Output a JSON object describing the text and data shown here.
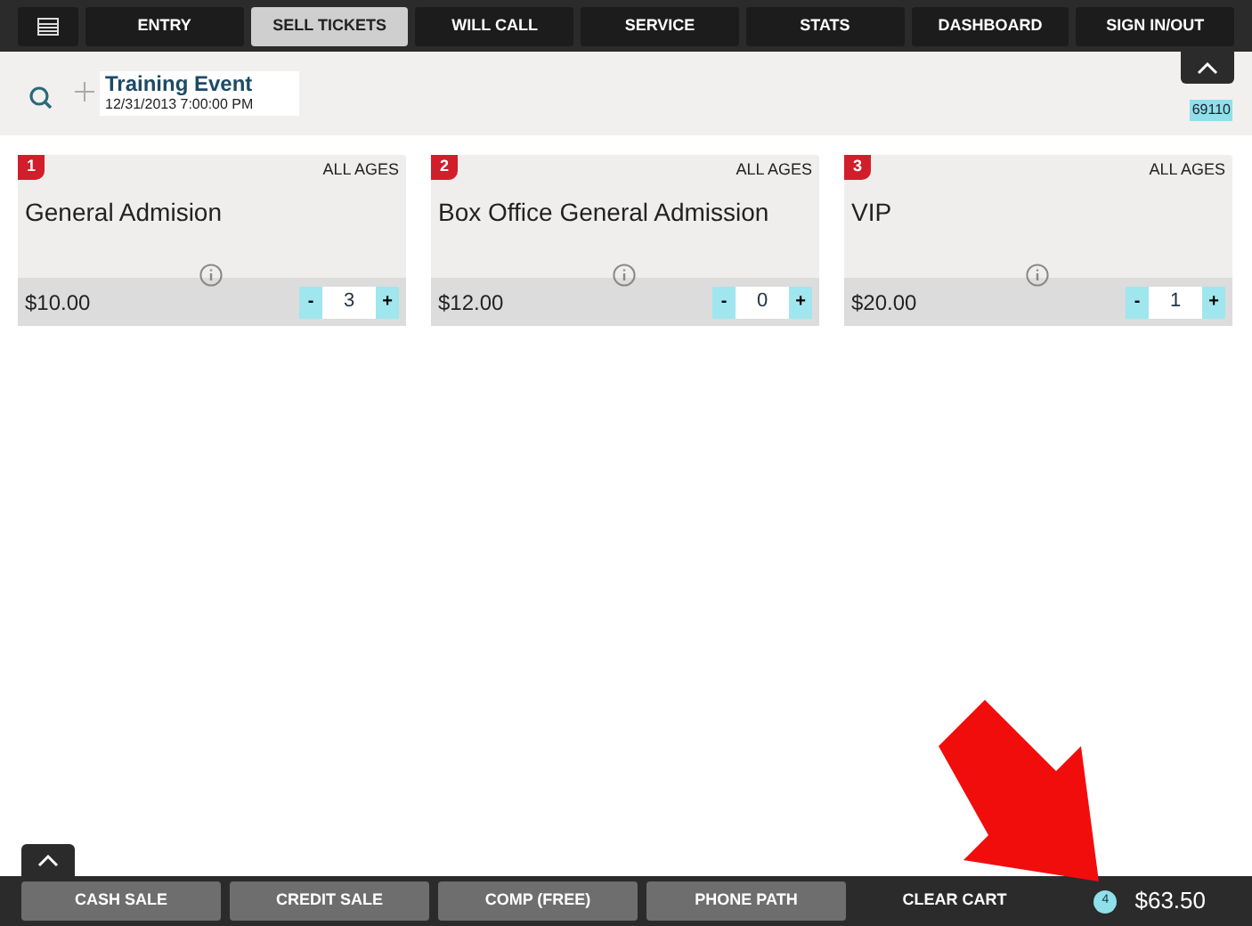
{
  "nav": {
    "tabs": [
      {
        "label": "ENTRY",
        "selected": false
      },
      {
        "label": "SELL TICKETS",
        "selected": true
      },
      {
        "label": "WILL CALL",
        "selected": false
      },
      {
        "label": "SERVICE",
        "selected": false
      },
      {
        "label": "STATS",
        "selected": false
      },
      {
        "label": "DASHBOARD",
        "selected": false
      },
      {
        "label": "SIGN IN/OUT",
        "selected": false
      }
    ]
  },
  "event": {
    "title": "Training Event",
    "date": "12/31/2013 7:00:00 PM",
    "code": "69110"
  },
  "tickets": [
    {
      "number": "1",
      "age": "ALL AGES",
      "name": "General Admision",
      "price": "$10.00",
      "minus": "-",
      "qty": "3",
      "plus": "+"
    },
    {
      "number": "2",
      "age": "ALL AGES",
      "name": "Box Office General Admission",
      "price": "$12.00",
      "minus": "-",
      "qty": "0",
      "plus": "+"
    },
    {
      "number": "3",
      "age": "ALL AGES",
      "name": "VIP",
      "price": "$20.00",
      "minus": "-",
      "qty": "1",
      "plus": "+"
    }
  ],
  "footer": {
    "buttons": [
      {
        "label": "CASH SALE",
        "kind": "filled"
      },
      {
        "label": "CREDIT SALE",
        "kind": "filled"
      },
      {
        "label": "COMP (FREE)",
        "kind": "filled"
      },
      {
        "label": "PHONE PATH",
        "kind": "filled"
      },
      {
        "label": "CLEAR CART",
        "kind": "plain"
      }
    ],
    "count": "4",
    "total": "$63.50"
  }
}
